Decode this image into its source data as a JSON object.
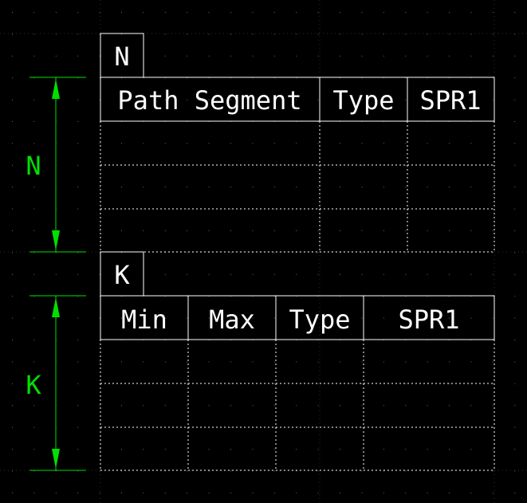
{
  "colors": {
    "background": "#000000",
    "table_lines": "#ffffff",
    "dimension": "#00e000",
    "grid_dots": "#6a6a6a"
  },
  "tables": [
    {
      "label": "N",
      "headers": [
        "Path Segment",
        "Type",
        "SPR1"
      ],
      "rows": [
        [
          "",
          "",
          ""
        ],
        [
          "",
          "",
          ""
        ],
        [
          "",
          "",
          ""
        ]
      ]
    },
    {
      "label": "K",
      "headers": [
        "Min",
        "Max",
        "Type",
        "SPR1"
      ],
      "rows": [
        [
          "",
          "",
          "",
          ""
        ],
        [
          "",
          "",
          "",
          ""
        ],
        [
          "",
          "",
          "",
          ""
        ]
      ]
    }
  ],
  "dimensions": [
    {
      "label": "N"
    },
    {
      "label": "K"
    }
  ]
}
